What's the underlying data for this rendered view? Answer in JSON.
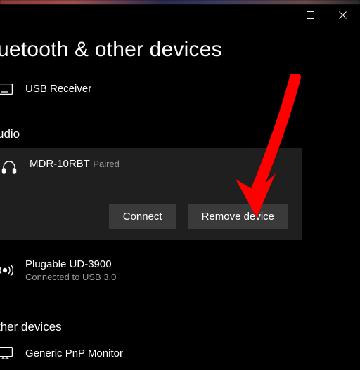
{
  "window": {
    "minimize_label": "Minimize",
    "maximize_label": "Maximize",
    "close_label": "Close"
  },
  "page_title": "uetooth & other devices",
  "sections": {
    "other1": {
      "usb_receiver": {
        "name": "USB Receiver"
      }
    },
    "audio": {
      "title": "udio",
      "selected": {
        "name": "MDR-10RBT",
        "status": "Paired",
        "connect_label": "Connect",
        "remove_label": "Remove device"
      },
      "plugable": {
        "name": "Plugable UD-3900",
        "status": "Connected to USB 3.0"
      }
    },
    "other2": {
      "title": "ther devices",
      "monitor": {
        "name": "Generic PnP Monitor"
      }
    }
  },
  "annotation": {
    "arrow_color": "#ff0000",
    "arrow_points_to": "remove-device-button"
  }
}
